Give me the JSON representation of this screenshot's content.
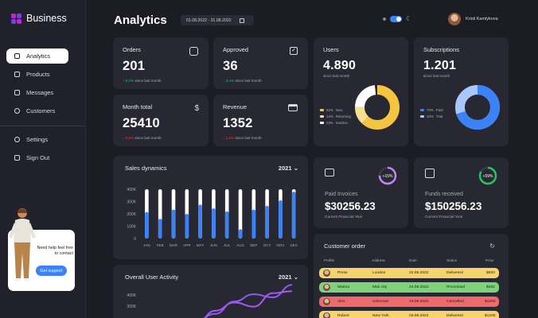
{
  "brand": {
    "name": "Business"
  },
  "sidebar": {
    "items": [
      {
        "label": "Analytics",
        "icon": "analytics-icon"
      },
      {
        "label": "Products",
        "icon": "box-icon"
      },
      {
        "label": "Messages",
        "icon": "mail-icon"
      },
      {
        "label": "Customers",
        "icon": "user-icon"
      }
    ],
    "items2": [
      {
        "label": "Settings",
        "icon": "gear-icon"
      },
      {
        "label": "Sign Out",
        "icon": "logout-icon"
      }
    ],
    "help": {
      "text": "Need help feel free to contact",
      "button": "Get support"
    }
  },
  "header": {
    "title": "Analytics",
    "date_range": "01.08.2022 - 31.08.2022",
    "user_name": "Kristi Kamlykova"
  },
  "stats": [
    {
      "title": "Orders",
      "value": "201",
      "delta": "8.2%",
      "trend": "up",
      "note": "since last month"
    },
    {
      "title": "Approved",
      "value": "36",
      "delta": "3.4%",
      "trend": "up",
      "note": "since last month"
    },
    {
      "title": "Month total",
      "value": "25410",
      "delta": "0.2%",
      "trend": "down",
      "note": "since last month"
    },
    {
      "title": "Revenue",
      "value": "1352",
      "delta": "1.2%",
      "trend": "down",
      "note": "since last month"
    }
  ],
  "users": {
    "title": "Users",
    "value": "4.890",
    "note": "since last month",
    "legend": [
      {
        "pct": "62%",
        "label": "New",
        "color": "#f5c542"
      },
      {
        "pct": "13%",
        "label": "Returning",
        "color": "#f7e08c"
      },
      {
        "pct": "23%",
        "label": "Inactive",
        "color": "#ffffff"
      }
    ]
  },
  "subscriptions": {
    "title": "Subscriptions",
    "value": "1.201",
    "note": "since last month",
    "legend": [
      {
        "pct": "70%",
        "label": "Paid",
        "color": "#3b82f6"
      },
      {
        "pct": "30%",
        "label": "Trial",
        "color": "#a9c7fb"
      }
    ]
  },
  "sales": {
    "title": "Sales dynamics",
    "year": "2021",
    "chart_data": {
      "type": "bar",
      "categories": [
        "JAN",
        "FEB",
        "MAR",
        "APR",
        "MAY",
        "JUN",
        "JUL",
        "AUG",
        "SEP",
        "OCT",
        "NOV",
        "DEC"
      ],
      "ylim": [
        0,
        400
      ],
      "y_ticks": [
        "400K",
        "300K",
        "200K",
        "100K",
        "0"
      ],
      "series": [
        {
          "values": [
            215,
            160,
            235,
            200,
            275,
            245,
            220,
            75,
            235,
            265,
            310,
            380
          ],
          "color": "#3b82f6"
        },
        {
          "values": [
            400,
            400,
            400,
            400,
            400,
            400,
            400,
            400,
            400,
            400,
            400,
            400
          ],
          "color": "#ffffff"
        }
      ]
    }
  },
  "activity": {
    "title": "Overall User Activity",
    "year": "2021",
    "chart_data": {
      "type": "line",
      "ylim": [
        0,
        400
      ],
      "y_ticks": [
        "400K",
        "300K"
      ],
      "series": [
        {
          "values": [
            50,
            70,
            140,
            260,
            330,
            300,
            420
          ],
          "color": "#8b5cf6"
        },
        {
          "values": [
            20,
            40,
            170,
            250,
            210,
            340,
            360
          ],
          "color": "#a855f7"
        }
      ]
    }
  },
  "paid_invoices": {
    "title": "Paid Invoices",
    "value": "$30256.23",
    "note": "Current Financial Year",
    "change": "+15%",
    "ring_color": "#c084fc"
  },
  "funds_received": {
    "title": "Funds received",
    "value": "$150256.23",
    "note": "Current Financial Year",
    "change": "+59%",
    "ring_color": "#22c55e"
  },
  "customer_order": {
    "title": "Customer order",
    "headers": [
      "Profile",
      "Address",
      "Date",
      "Status",
      "Price"
    ],
    "rows": [
      {
        "name": "Press",
        "address": "London",
        "date": "22.08.2022",
        "status": "Delivered",
        "price": "$920",
        "color": "#f5d36e"
      },
      {
        "name": "Marina",
        "address": "Man city",
        "date": "24.08.2022",
        "status": "Processed",
        "price": "$452",
        "color": "#7ed37a"
      },
      {
        "name": "Alex",
        "address": "Unknown",
        "date": "18.08.2022",
        "status": "Cancelled",
        "price": "$1200",
        "color": "#ef6b6b"
      },
      {
        "name": "Robert",
        "address": "New York",
        "date": "03.08.2022",
        "status": "Delivered",
        "price": "$1235",
        "color": "#f5d36e"
      }
    ]
  }
}
